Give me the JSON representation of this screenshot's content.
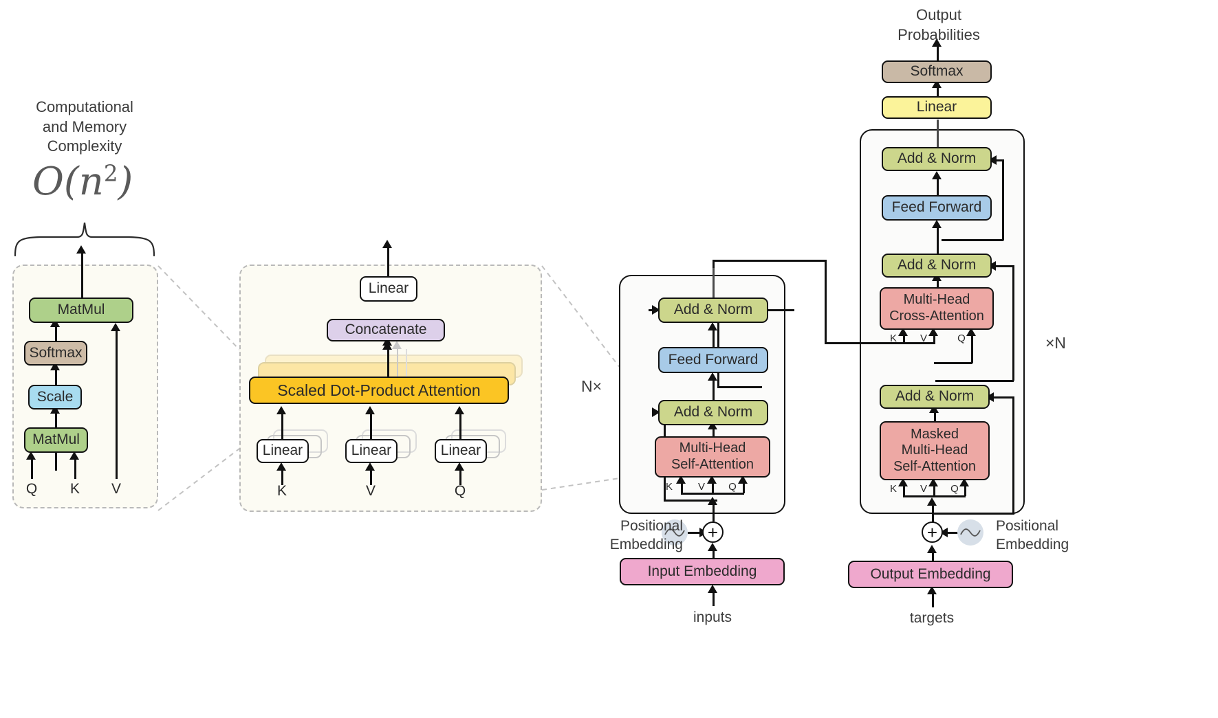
{
  "annotations": {
    "complexity_caption": "Computational\nand Memory\nComplexity",
    "complexity_value_base": "O(n",
    "complexity_value_exp": "2",
    "complexity_value_close": ")",
    "encoder_repeat": "N×",
    "decoder_repeat": "×N",
    "output_probabilities": "Output\nProbabilities",
    "inputs_label": "inputs",
    "targets_label": "targets",
    "positional_embedding_left": "Positional\nEmbedding",
    "positional_embedding_right": "Positional\nEmbedding"
  },
  "scaled_dot_product_panel": {
    "nodes": [
      {
        "id": "sdp-matmul-top",
        "label": "MatMul",
        "color": "#aed08a"
      },
      {
        "id": "sdp-softmax",
        "label": "Softmax",
        "color": "#cdbba6"
      },
      {
        "id": "sdp-scale",
        "label": "Scale",
        "color": "#a8dcf0"
      },
      {
        "id": "sdp-matmul-bottom",
        "label": "MatMul",
        "color": "#aed08a"
      }
    ],
    "inputs": [
      "Q",
      "K",
      "V"
    ]
  },
  "multi_head_panel": {
    "nodes": [
      {
        "id": "mh-linear-out",
        "label": "Linear",
        "color": "#ffffff"
      },
      {
        "id": "mh-concatenate",
        "label": "Concatenate",
        "color": "#ddd0ea"
      },
      {
        "id": "mh-sdpa",
        "label": "Scaled Dot-Product Attention",
        "color": "#fbc524"
      },
      {
        "id": "mh-linear-k",
        "label": "Linear",
        "color": "#ffffff"
      },
      {
        "id": "mh-linear-v",
        "label": "Linear",
        "color": "#ffffff"
      },
      {
        "id": "mh-linear-q",
        "label": "Linear",
        "color": "#ffffff"
      }
    ],
    "inputs": [
      "K",
      "V",
      "Q"
    ]
  },
  "encoder": {
    "nodes": [
      {
        "id": "enc-add-norm-2",
        "label": "Add & Norm",
        "color": "#ccd68c"
      },
      {
        "id": "enc-feed-forward",
        "label": "Feed Forward",
        "color": "#a8cbe8"
      },
      {
        "id": "enc-add-norm-1",
        "label": "Add & Norm",
        "color": "#ccd68c"
      },
      {
        "id": "enc-self-attention",
        "label": "Multi-Head\nSelf-Attention",
        "color": "#eda8a4"
      }
    ],
    "attention_inputs": [
      "K",
      "V",
      "Q"
    ],
    "embedding": {
      "id": "input-embedding",
      "label": "Input Embedding",
      "color": "#efa8cd"
    }
  },
  "decoder": {
    "nodes": [
      {
        "id": "dec-softmax",
        "label": "Softmax",
        "color": "#c9b9a6"
      },
      {
        "id": "dec-linear",
        "label": "Linear",
        "color": "#fbf39a"
      },
      {
        "id": "dec-add-norm-3",
        "label": "Add & Norm",
        "color": "#ccd68c"
      },
      {
        "id": "dec-feed-forward",
        "label": "Feed Forward",
        "color": "#a8cbe8"
      },
      {
        "id": "dec-add-norm-2",
        "label": "Add & Norm",
        "color": "#ccd68c"
      },
      {
        "id": "dec-cross-attention",
        "label": "Multi-Head\nCross-Attention",
        "color": "#eda8a4"
      },
      {
        "id": "dec-add-norm-1",
        "label": "Add & Norm",
        "color": "#ccd68c"
      },
      {
        "id": "dec-masked-self-attention",
        "label": "Masked\nMulti-Head\nSelf-Attention",
        "color": "#eda8a4"
      }
    ],
    "cross_attention_inputs": [
      "K",
      "V",
      "Q"
    ],
    "masked_attention_inputs": [
      "K",
      "V",
      "Q"
    ],
    "embedding": {
      "id": "output-embedding",
      "label": "Output Embedding",
      "color": "#efa8cd"
    }
  },
  "colors": {
    "green": "#aed08a",
    "olive": "#ccd68c",
    "blue": "#a8cbe8",
    "lightblue": "#a8dcf0",
    "tan": "#cdbba6",
    "taupe": "#c9b9a6",
    "purple": "#ddd0ea",
    "amber": "#fbc524",
    "salmon": "#eda8a4",
    "pink": "#efa8cd",
    "yellow": "#fbf39a",
    "white": "#ffffff",
    "panel_bg": "#fcfbf3",
    "dash_border": "#b9b9b9"
  }
}
